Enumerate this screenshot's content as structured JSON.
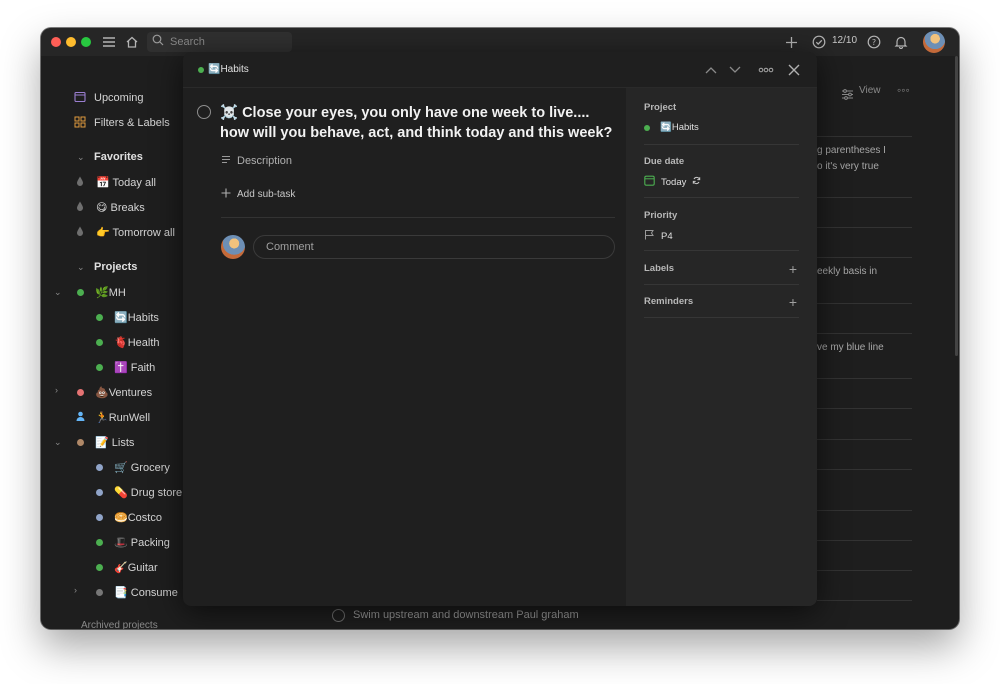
{
  "topbar": {
    "search_placeholder": "Search",
    "counter": "12/10"
  },
  "sidebar": {
    "upcoming": "Upcoming",
    "filters": "Filters & Labels",
    "favorites_header": "Favorites",
    "favorites": [
      {
        "label": "📅 Today all"
      },
      {
        "label": "😋 Breaks"
      },
      {
        "label": "👉 Tomorrow all"
      }
    ],
    "projects_header": "Projects",
    "projects": [
      {
        "label": "🌿MH",
        "color": "#4caf50"
      },
      {
        "label": "🔄Habits",
        "color": "#4caf50"
      },
      {
        "label": "🫀Health",
        "color": "#4caf50"
      },
      {
        "label": "✝️ Faith",
        "color": "#4caf50"
      },
      {
        "label": "💩Ventures",
        "color": "#e57373"
      },
      {
        "label": "🏃RunWell",
        "color": "#64b5f6"
      },
      {
        "label": "📝 Lists",
        "color": "#b08968"
      },
      {
        "label": "🛒 Grocery",
        "color": "#90a4c8"
      },
      {
        "label": "💊 Drug store",
        "color": "#90a4c8"
      },
      {
        "label": "🥯Costco",
        "color": "#90a4c8"
      },
      {
        "label": "🎩 Packing",
        "color": "#4caf50"
      },
      {
        "label": "🎸Guitar",
        "color": "#4caf50"
      },
      {
        "label": "📑 Consume",
        "color": "#777777"
      }
    ],
    "archived": "Archived projects"
  },
  "background": {
    "view_label": "View",
    "snippets": [
      "g parentheses I",
      "o it's very true",
      "eekly basis in",
      "ve my blue line"
    ],
    "bottom_task": "Swim upstream and downstream Paul graham"
  },
  "modal": {
    "breadcrumb": "🔄Habits",
    "task_title": "☠️ Close your eyes, you only have one week to live.... how will you behave, act, and think today and this week?",
    "description_label": "Description",
    "add_subtask": "Add sub-task",
    "comment_placeholder": "Comment",
    "panel": {
      "project_label": "Project",
      "project_value": "🔄Habits",
      "due_label": "Due date",
      "due_value": "Today",
      "priority_label": "Priority",
      "priority_value": "P4",
      "labels_label": "Labels",
      "reminders_label": "Reminders"
    }
  },
  "colors": {
    "accent_green": "#4caf50",
    "bg": "#1e1e1e",
    "panel": "#262626"
  }
}
